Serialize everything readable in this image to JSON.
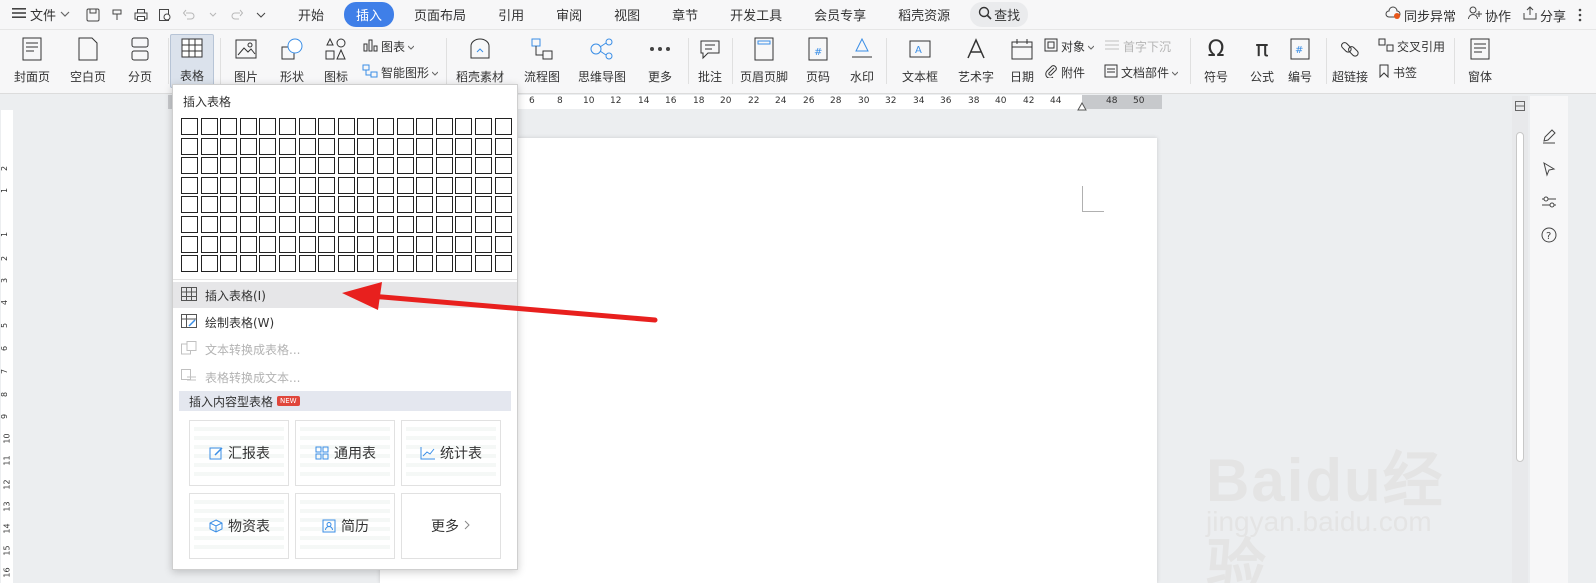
{
  "menubar": {
    "file": "文件",
    "tabs": [
      "开始",
      "插入",
      "页面布局",
      "引用",
      "审阅",
      "视图",
      "章节",
      "开发工具",
      "会员专享",
      "稻壳资源"
    ],
    "active_tab": "插入",
    "search": "查找",
    "right": {
      "sync": "同步异常",
      "collab": "协作",
      "share": "分享"
    }
  },
  "ribbon": {
    "cover": "封面页",
    "blank": "空白页",
    "pagebreak": "分页",
    "table": "表格",
    "picture": "图片",
    "shape": "形状",
    "icon": "图标",
    "chart": "图表",
    "smartart": "智能图形",
    "daoke": "稻壳素材",
    "flow": "流程图",
    "mind": "思维导图",
    "more": "更多",
    "comment": "批注",
    "header_footer": "页眉页脚",
    "page_num": "页码",
    "watermark": "水印",
    "textbox": "文本框",
    "wordart": "艺术字",
    "date": "日期",
    "object": "对象",
    "attach": "附件",
    "dropcap": "首字下沉",
    "docpart": "文档部件",
    "symbol": "符号",
    "formula": "公式",
    "numbering": "编号",
    "hyperlink": "超链接",
    "crossref": "交叉引用",
    "bookmark": "书签",
    "window": "窗体"
  },
  "ruler": {
    "h_numbers": [
      "6",
      "8",
      "10",
      "12",
      "14",
      "16",
      "18",
      "20",
      "22",
      "24",
      "26",
      "28",
      "30",
      "32",
      "34",
      "36",
      "38",
      "40",
      "42",
      "44",
      "48",
      "50"
    ],
    "v_numbers": [
      "2",
      "1",
      "1",
      "2",
      "3",
      "4",
      "5",
      "6",
      "7",
      "8",
      "9",
      "10",
      "11",
      "12",
      "13",
      "14",
      "15",
      "16"
    ]
  },
  "dropdown": {
    "header": "插入表格",
    "grid_cols": 17,
    "grid_rows": 8,
    "items": {
      "insert_table": "插入表格(I)",
      "draw_table": "绘制表格(W)",
      "text_to_table": "文本转换成表格...",
      "table_to_text": "表格转换成文本..."
    },
    "section": "插入内容型表格",
    "new_badge": "NEW",
    "templates": {
      "report": "汇报表",
      "general": "通用表",
      "stats": "统计表",
      "supplies": "物资表",
      "resume": "简历",
      "more": "更多"
    }
  },
  "watermark": {
    "main": "Baidu经验",
    "sub": "jingyan.baidu.com"
  },
  "colors": {
    "accent": "#3f7fe8",
    "arrow": "#e8201e",
    "selected": "#dbe2ec"
  }
}
